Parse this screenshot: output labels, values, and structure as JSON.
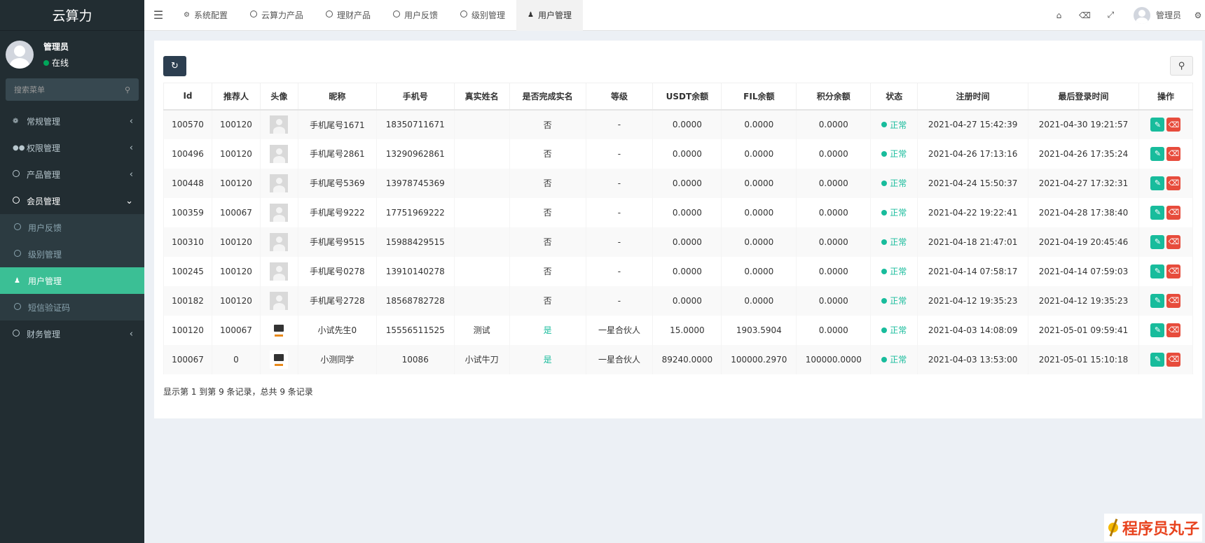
{
  "app": {
    "title": "云算力"
  },
  "user": {
    "name": "管理员",
    "status": "在线"
  },
  "sidebar": {
    "search_placeholder": "搜索菜单",
    "items": [
      {
        "label": "常规管理",
        "icon": "cogs-icon"
      },
      {
        "label": "权限管理",
        "icon": "group-icon"
      },
      {
        "label": "产品管理",
        "icon": "circle-icon"
      },
      {
        "label": "会员管理",
        "icon": "circle-icon"
      }
    ],
    "submenu": [
      {
        "label": "用户反馈"
      },
      {
        "label": "级别管理"
      },
      {
        "label": "用户管理"
      },
      {
        "label": "短信验证码"
      }
    ],
    "finance": {
      "label": "财务管理"
    }
  },
  "tabs": [
    {
      "label": "系统配置"
    },
    {
      "label": "云算力产品"
    },
    {
      "label": "理财产品"
    },
    {
      "label": "用户反馈"
    },
    {
      "label": "级别管理"
    },
    {
      "label": "用户管理"
    }
  ],
  "topbar": {
    "admin_label": "管理员"
  },
  "table": {
    "headers": [
      "Id",
      "推荐人",
      "头像",
      "昵称",
      "手机号",
      "真实姓名",
      "是否完成实名",
      "等级",
      "USDT余额",
      "FIL余额",
      "积分余额",
      "状态",
      "注册时间",
      "最后登录时间",
      "操作"
    ],
    "rows": [
      {
        "id": "100570",
        "ref": "100120",
        "avatar": "default",
        "nick": "手机尾号1671",
        "phone": "18350711671",
        "realname": "",
        "verified": "否",
        "level": "-",
        "usdt": "0.0000",
        "fil": "0.0000",
        "points": "0.0000",
        "status": "正常",
        "reg": "2021-04-27 15:42:39",
        "last": "2021-04-30 19:21:57"
      },
      {
        "id": "100496",
        "ref": "100120",
        "avatar": "default",
        "nick": "手机尾号2861",
        "phone": "13290962861",
        "realname": "",
        "verified": "否",
        "level": "-",
        "usdt": "0.0000",
        "fil": "0.0000",
        "points": "0.0000",
        "status": "正常",
        "reg": "2021-04-26 17:13:16",
        "last": "2021-04-26 17:35:24"
      },
      {
        "id": "100448",
        "ref": "100120",
        "avatar": "default",
        "nick": "手机尾号5369",
        "phone": "13978745369",
        "realname": "",
        "verified": "否",
        "level": "-",
        "usdt": "0.0000",
        "fil": "0.0000",
        "points": "0.0000",
        "status": "正常",
        "reg": "2021-04-24 15:50:37",
        "last": "2021-04-27 17:32:31"
      },
      {
        "id": "100359",
        "ref": "100067",
        "avatar": "default",
        "nick": "手机尾号9222",
        "phone": "17751969222",
        "realname": "",
        "verified": "否",
        "level": "-",
        "usdt": "0.0000",
        "fil": "0.0000",
        "points": "0.0000",
        "status": "正常",
        "reg": "2021-04-22 19:22:41",
        "last": "2021-04-28 17:38:40"
      },
      {
        "id": "100310",
        "ref": "100120",
        "avatar": "default",
        "nick": "手机尾号9515",
        "phone": "15988429515",
        "realname": "",
        "verified": "否",
        "level": "-",
        "usdt": "0.0000",
        "fil": "0.0000",
        "points": "0.0000",
        "status": "正常",
        "reg": "2021-04-18 21:47:01",
        "last": "2021-04-19 20:45:46"
      },
      {
        "id": "100245",
        "ref": "100120",
        "avatar": "default",
        "nick": "手机尾号0278",
        "phone": "13910140278",
        "realname": "",
        "verified": "否",
        "level": "-",
        "usdt": "0.0000",
        "fil": "0.0000",
        "points": "0.0000",
        "status": "正常",
        "reg": "2021-04-14 07:58:17",
        "last": "2021-04-14 07:59:03"
      },
      {
        "id": "100182",
        "ref": "100120",
        "avatar": "default",
        "nick": "手机尾号2728",
        "phone": "18568782728",
        "realname": "",
        "verified": "否",
        "level": "-",
        "usdt": "0.0000",
        "fil": "0.0000",
        "points": "0.0000",
        "status": "正常",
        "reg": "2021-04-12 19:35:23",
        "last": "2021-04-12 19:35:23"
      },
      {
        "id": "100120",
        "ref": "100067",
        "avatar": "pc",
        "nick": "小试先生0",
        "phone": "15556511525",
        "realname": "测试",
        "verified": "是",
        "level": "一星合伙人",
        "usdt": "15.0000",
        "fil": "1903.5904",
        "points": "0.0000",
        "status": "正常",
        "reg": "2021-04-03 14:08:09",
        "last": "2021-05-01 09:59:41"
      },
      {
        "id": "100067",
        "ref": "0",
        "avatar": "pc",
        "nick": "小测同学",
        "phone": "10086",
        "realname": "小试牛刀",
        "verified": "是",
        "level": "一星合伙人",
        "usdt": "89240.0000",
        "fil": "100000.2970",
        "points": "100000.0000",
        "status": "正常",
        "reg": "2021-04-03 13:53:00",
        "last": "2021-05-01 15:10:18"
      }
    ]
  },
  "pager": {
    "info": "显示第 1 到第 9 条记录，总共 9 条记录"
  },
  "watermark": {
    "text": "程序员丸子"
  },
  "colors": {
    "accent": "#3bbf95",
    "success": "#18bc9c",
    "danger": "#e74c3c",
    "sidebar": "#222d32"
  }
}
